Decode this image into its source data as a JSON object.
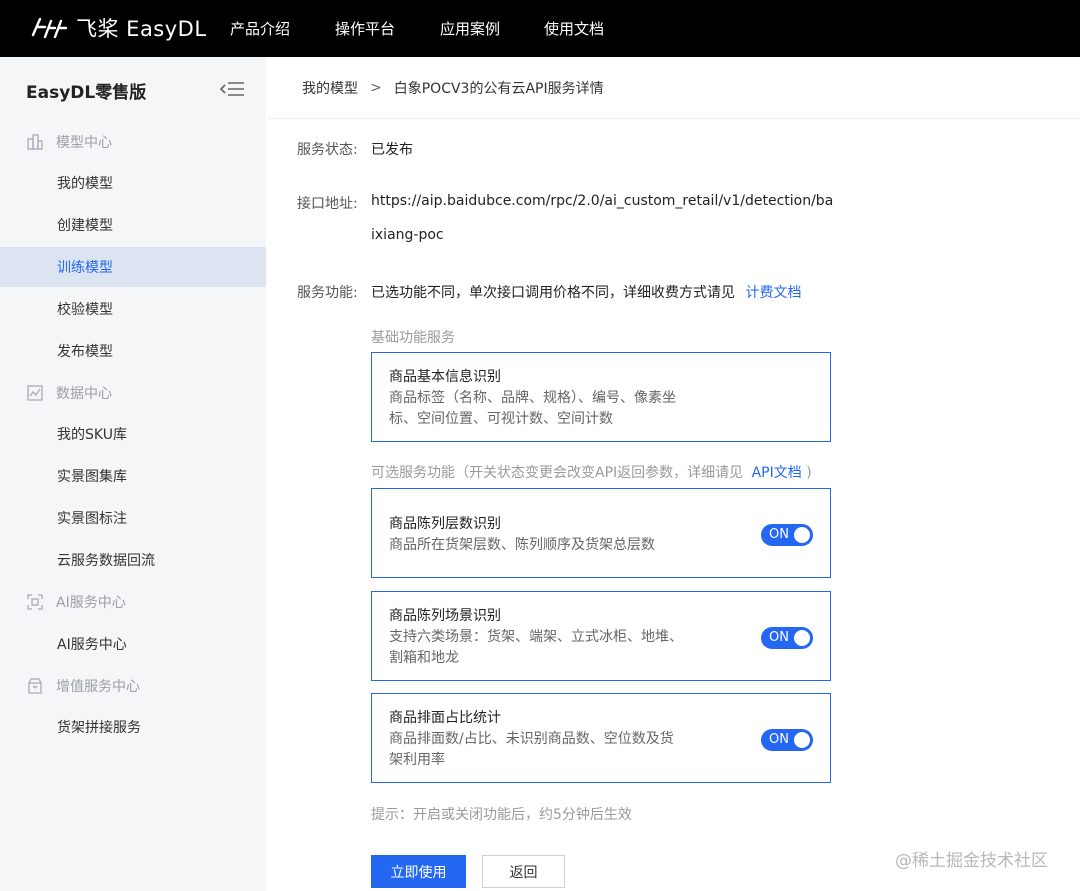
{
  "topbar": {
    "logo_text": "飞桨 EasyDL",
    "nav": [
      "产品介绍",
      "操作平台",
      "应用案例",
      "使用文档"
    ]
  },
  "sidebar": {
    "title": "EasyDL零售版",
    "sections": [
      {
        "label": "模型中心",
        "icon": "model-center-icon",
        "items": [
          "我的模型",
          "创建模型",
          "训练模型",
          "校验模型",
          "发布模型"
        ]
      },
      {
        "label": "数据中心",
        "icon": "data-center-icon",
        "items": [
          "我的SKU库",
          "实景图集库",
          "实景图标注",
          "云服务数据回流"
        ]
      },
      {
        "label": "AI服务中心",
        "icon": "ai-service-icon",
        "items": [
          "AI服务中心"
        ]
      },
      {
        "label": "增值服务中心",
        "icon": "value-added-icon",
        "items": [
          "货架拼接服务"
        ]
      }
    ],
    "active_item": "训练模型"
  },
  "breadcrumb": {
    "parent": "我的模型",
    "separator": ">",
    "current": "白象POCV3的公有云API服务详情"
  },
  "service": {
    "status_label": "服务状态:",
    "status_value": "已发布",
    "endpoint_label": "接口地址:",
    "endpoint_line1": "https://aip.baidubce.com/rpc/2.0/ai_custom_retail/v1/detection/ba",
    "endpoint_line2": "ixiang-poc",
    "function_label": "服务功能:",
    "function_text": "已选功能不同，单次接口调用价格不同，详细收费方式请见",
    "function_link": "计费文档"
  },
  "basic_group": {
    "label": "基础功能服务",
    "card": {
      "title": "商品基本信息识别",
      "desc_line1": "商品标签（名称、品牌、规格）、编号、像素坐",
      "desc_line2": "标、空间位置、可视计数、空间计数"
    }
  },
  "optional_group": {
    "label": "可选服务功能（开关状态变更会改变API返回参数，详细请见",
    "link": "API文档",
    "label_end": ")",
    "cards": [
      {
        "title": "商品陈列层数识别",
        "desc_line1": "商品所在货架层数、陈列顺序及货架总层数",
        "desc_line2": "",
        "toggle": "ON"
      },
      {
        "title": "商品陈列场景识别",
        "desc_line1": "支持六类场景：货架、端架、立式冰柜、地堆、",
        "desc_line2": "割箱和地龙",
        "toggle": "ON"
      },
      {
        "title": "商品排面占比统计",
        "desc_line1": "商品排面数/占比、未识别商品数、空位数及货",
        "desc_line2": "架利用率",
        "toggle": "ON"
      }
    ]
  },
  "tip": "提示：开启或关闭功能后，约5分钟后生效",
  "buttons": {
    "primary": "立即使用",
    "back": "返回"
  },
  "watermark": "@稀土掘金技术社区",
  "colors": {
    "accent": "#2468f2",
    "topbar": "#000000",
    "sidebar_bg": "#f5f6f8",
    "active_bg": "#dde4f1"
  }
}
